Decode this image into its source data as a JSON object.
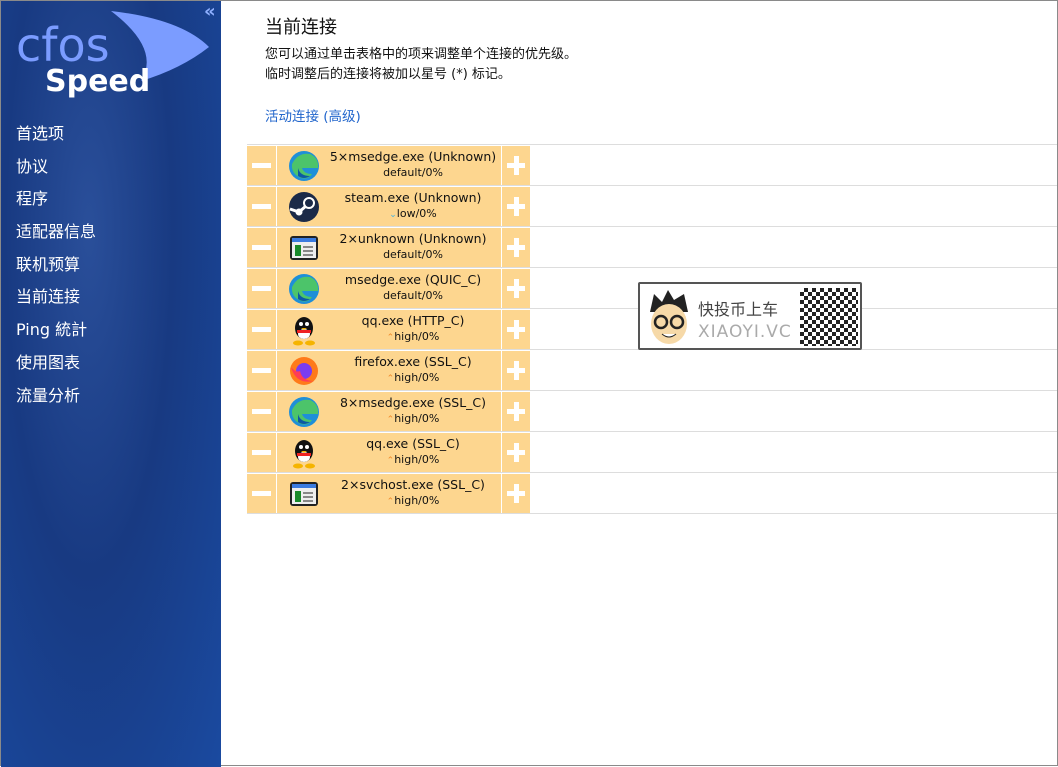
{
  "app": {
    "logo_text_top": "cfos",
    "logo_text_bottom": "Speed",
    "collapse_label": "«"
  },
  "sidebar": {
    "items": [
      {
        "label": "首选项"
      },
      {
        "label": "协议"
      },
      {
        "label": "程序"
      },
      {
        "label": "适配器信息"
      },
      {
        "label": "联机预算"
      },
      {
        "label": "当前连接"
      },
      {
        "label": "Ping 統計"
      },
      {
        "label": "使用图表"
      },
      {
        "label": "流量分析"
      }
    ]
  },
  "main": {
    "title": "当前连接",
    "desc1": "您可以通过单击表格中的项来调整单个连接的优先级。",
    "desc2": "临时调整后的连接将被加以星号 (*) 标记。",
    "link": "活动连接 (高级)"
  },
  "connections": [
    {
      "name": "5×msedge.exe (Unknown)",
      "priority": "default/0%",
      "arrow": "",
      "icon": "edge-icon"
    },
    {
      "name": "steam.exe (Unknown)",
      "priority": "low/0%",
      "arrow": "⌄",
      "icon": "steam-icon"
    },
    {
      "name": "2×unknown (Unknown)",
      "priority": "default/0%",
      "arrow": "",
      "icon": "window-icon"
    },
    {
      "name": "msedge.exe (QUIC_C)",
      "priority": "default/0%",
      "arrow": "",
      "icon": "edge-icon"
    },
    {
      "name": "qq.exe (HTTP_C)",
      "priority": "high/0%",
      "arrow": "⌃",
      "icon": "qq-icon"
    },
    {
      "name": "firefox.exe (SSL_C)",
      "priority": "high/0%",
      "arrow": "⌃",
      "icon": "firefox-icon"
    },
    {
      "name": "8×msedge.exe (SSL_C)",
      "priority": "high/0%",
      "arrow": "⌃",
      "icon": "edge-icon"
    },
    {
      "name": "qq.exe (SSL_C)",
      "priority": "high/0%",
      "arrow": "⌃",
      "icon": "qq-icon"
    },
    {
      "name": "2×svchost.exe (SSL_C)",
      "priority": "high/0%",
      "arrow": "⌃",
      "icon": "window-icon"
    }
  ],
  "watermark": {
    "line1": "快投币上车",
    "line2": "XIAOYI.VC"
  }
}
